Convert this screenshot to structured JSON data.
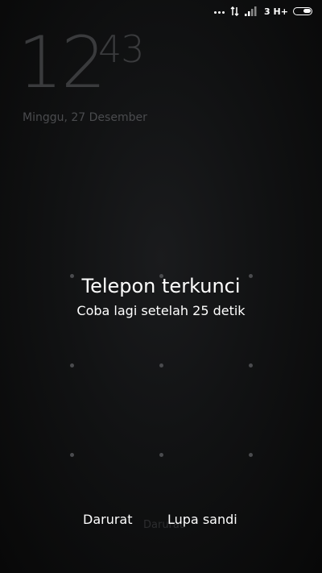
{
  "status_bar": {
    "carrier_label": "3 H+",
    "battery_level": 0.5,
    "icons": [
      "more-dots-icon",
      "data-transfer-icon",
      "signal-bars-icon",
      "battery-icon"
    ]
  },
  "clock": {
    "hour": "12",
    "minute": "43",
    "date": "Minggu, 27 Desember"
  },
  "lock_message": {
    "title": "Telepon terkunci",
    "subtitle": "Coba lagi setelah 25 detik"
  },
  "bottom": {
    "emergency_label": "Darurat",
    "forgot_label": "Lupa sandi",
    "ghost_emergency_label": "Darurat"
  },
  "colors": {
    "text": "#ffffff",
    "dimmed": "#3a3b3d",
    "background": "#111213"
  }
}
